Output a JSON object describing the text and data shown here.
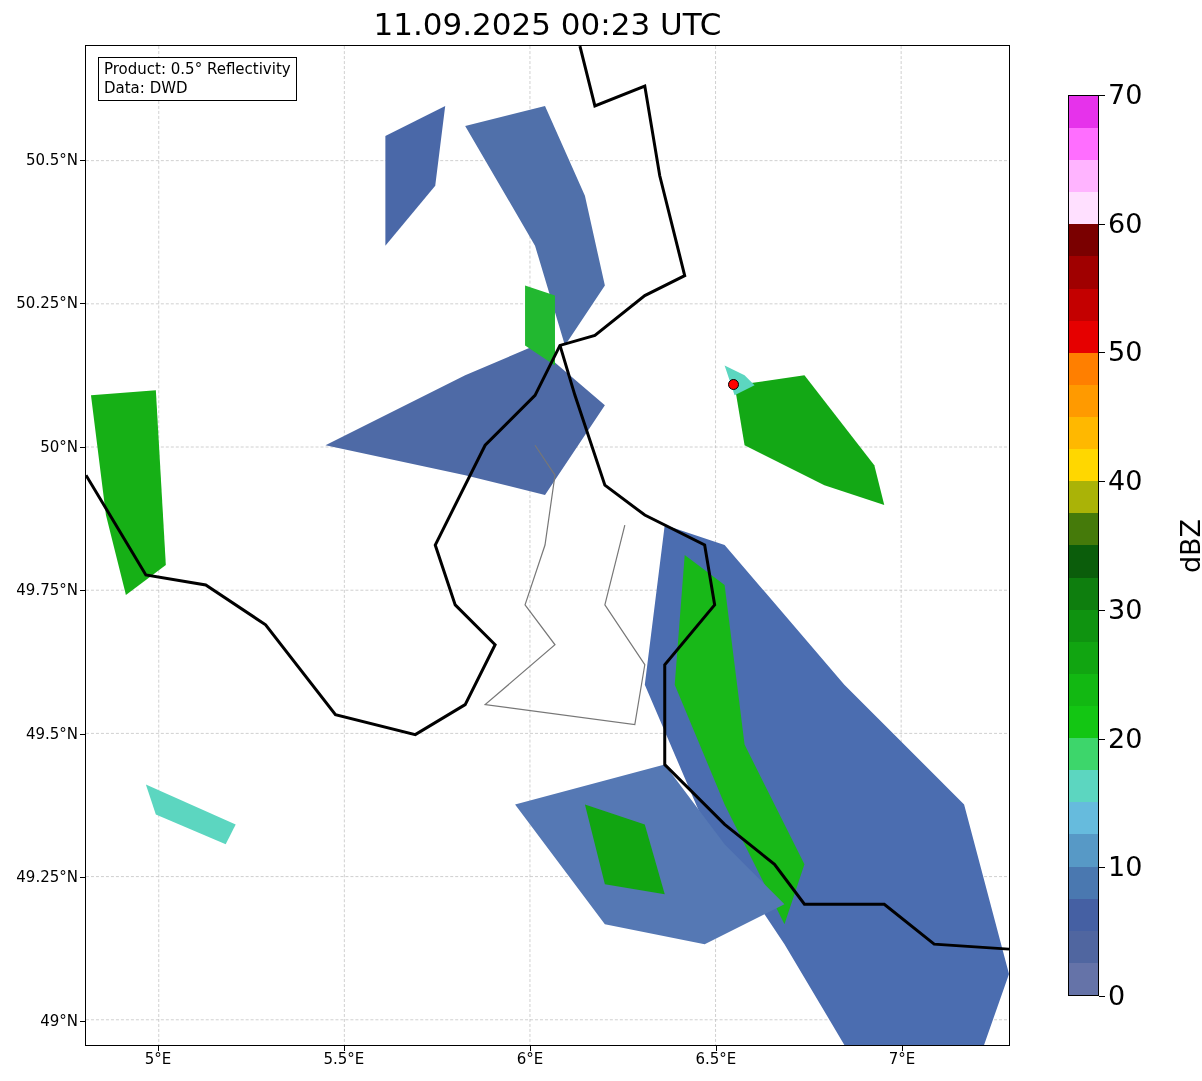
{
  "title": "11.09.2025 00:23 UTC",
  "legend": [
    "Product: 0.5° Reflectivity",
    "Data: DWD"
  ],
  "map": {
    "xticks": [
      "5°E",
      "5.5°E",
      "6°E",
      "6.5°E",
      "7°E"
    ],
    "yticks": [
      "50.5°N",
      "50.25°N",
      "50°N",
      "49.75°N",
      "49.5°N",
      "49.25°N",
      "49°N"
    ],
    "site": {
      "color": "#ff0000"
    }
  },
  "colorbar": {
    "label": "dBZ",
    "ticks": [
      "70",
      "60",
      "50",
      "40",
      "30",
      "20",
      "10",
      "0"
    ]
  }
}
